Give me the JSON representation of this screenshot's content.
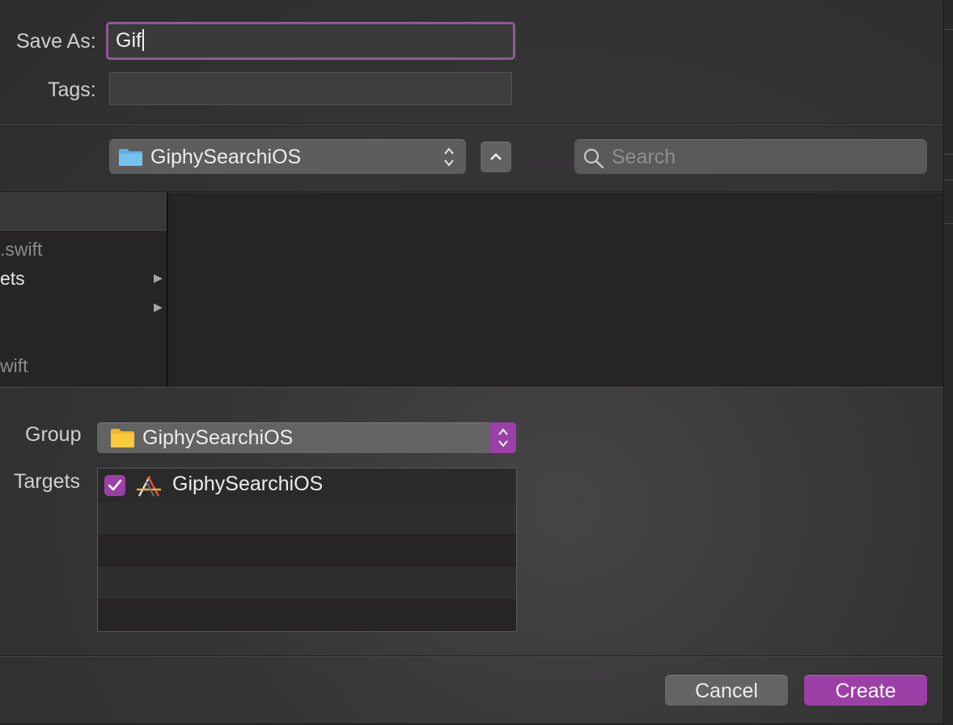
{
  "save_as": {
    "label": "Save As:",
    "value": "Gif"
  },
  "tags": {
    "label": "Tags:",
    "value": ""
  },
  "location": {
    "folder": "GiphySearchiOS"
  },
  "search": {
    "placeholder": "Search"
  },
  "browser": {
    "items": [
      {
        "text": ".swift",
        "has_children": false
      },
      {
        "text": "ets",
        "has_children": true
      },
      {
        "text": "",
        "has_children": true
      },
      {
        "text": "wift",
        "has_children": false
      }
    ]
  },
  "group": {
    "label": "Group",
    "value": "GiphySearchiOS"
  },
  "targets": {
    "label": "Targets",
    "rows": [
      {
        "name": "GiphySearchiOS",
        "checked": true
      }
    ]
  },
  "buttons": {
    "cancel": "Cancel",
    "create": "Create"
  },
  "colors": {
    "accent": "#9c40a7",
    "focus_ring": "#8b5c91",
    "background": "#363536"
  }
}
